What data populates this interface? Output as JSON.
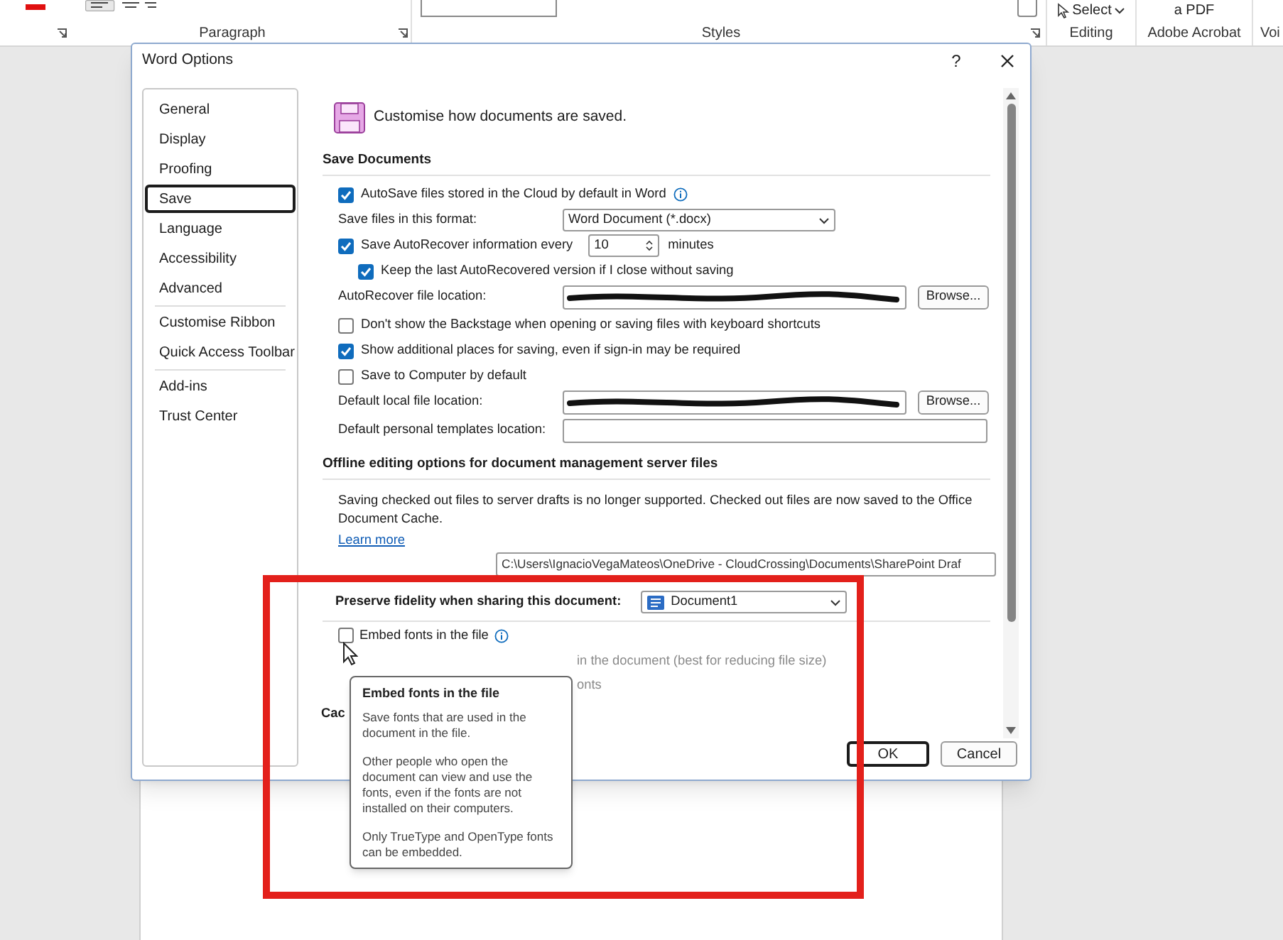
{
  "ribbon": {
    "groups": [
      {
        "kind": "paragraph",
        "label": "Paragraph"
      },
      {
        "kind": "styles",
        "label": "Styles"
      },
      {
        "kind": "editing",
        "label": "Editing",
        "button": "Select"
      },
      {
        "kind": "acrobat",
        "label": "Adobe Acrobat",
        "button": "a PDF"
      },
      {
        "kind": "voice",
        "label": "Voi"
      }
    ]
  },
  "dialog": {
    "title": "Word Options",
    "help": "?",
    "sidebar": {
      "items": [
        {
          "label": "General",
          "selected": false
        },
        {
          "label": "Display",
          "selected": false
        },
        {
          "label": "Proofing",
          "selected": false
        },
        {
          "label": "Save",
          "selected": true
        },
        {
          "label": "Language",
          "selected": false
        },
        {
          "label": "Accessibility",
          "selected": false
        },
        {
          "label": "Advanced",
          "selected": false
        },
        {
          "label": "Customise Ribbon",
          "selected": false
        },
        {
          "label": "Quick Access Toolbar",
          "selected": false
        },
        {
          "label": "Add-ins",
          "selected": false
        },
        {
          "label": "Trust Center",
          "selected": false
        }
      ]
    },
    "header": "Customise how documents are saved.",
    "save_documents": {
      "heading": "Save Documents",
      "rows": [
        {
          "kind": "checkbox",
          "label": "AutoSave files stored in the Cloud by default in Word",
          "checked": true,
          "info": true
        },
        {
          "kind": "dropdown",
          "label": "Save files in this format:",
          "value": "Word Document (*.docx)"
        },
        {
          "kind": "spin",
          "label": "Save AutoRecover information every",
          "checked": true,
          "value": "10",
          "unit": "minutes",
          "children": [
            {
              "kind": "checkbox",
              "label": "Keep the last AutoRecovered version if I close without saving",
              "checked": true
            }
          ]
        },
        {
          "kind": "path",
          "label": "AutoRecover file location:",
          "redacted": true,
          "button": "Browse..."
        },
        {
          "kind": "checkbox",
          "label": "Don't show the Backstage when opening or saving files with keyboard shortcuts",
          "checked": false
        },
        {
          "kind": "checkbox",
          "label": "Show additional places for saving, even if sign-in may be required",
          "checked": true
        },
        {
          "kind": "checkbox",
          "label": "Save to Computer by default",
          "checked": false
        },
        {
          "kind": "path",
          "label": "Default local file location:",
          "redacted": true,
          "button": "Browse..."
        },
        {
          "kind": "field",
          "label": "Default personal templates location:"
        }
      ]
    },
    "offline": {
      "heading": "Offline editing options for document management server files",
      "note": "Saving checked out files to server drafts is no longer supported. Checked out files are now saved to the Office Document Cache.",
      "link": "Learn more",
      "drafts_value": "C:\\Users\\IgnacioVegaMateos\\OneDrive - CloudCrossing\\Documents\\SharePoint Draf"
    },
    "fidelity": {
      "label": "Preserve fidelity when sharing this document:",
      "document": "Document1",
      "embed": {
        "label": "Embed fonts in the file",
        "checked": false,
        "info": true
      },
      "partial_rows": [
        "in the document (best for reducing file size)",
        "onts"
      ],
      "next_heading": "Cac"
    },
    "buttons": [
      {
        "label": "OK",
        "default": true
      },
      {
        "label": "Cancel",
        "default": false
      }
    ]
  },
  "tooltip": {
    "title": "Embed fonts in the file",
    "paragraphs": [
      "Save fonts that are used in the document in the file.",
      "Other people who open the document can view and use the fonts, even if the fonts are not installed on their computers.",
      "Only TrueType and OpenType fonts can be embedded."
    ]
  }
}
